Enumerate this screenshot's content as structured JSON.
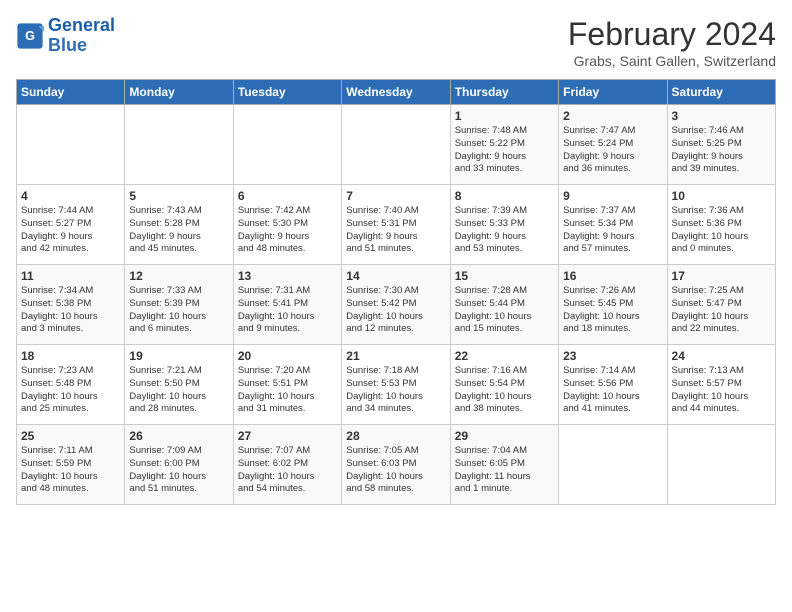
{
  "header": {
    "logo_general": "General",
    "logo_blue": "Blue",
    "month_title": "February 2024",
    "subtitle": "Grabs, Saint Gallen, Switzerland"
  },
  "days_of_week": [
    "Sunday",
    "Monday",
    "Tuesday",
    "Wednesday",
    "Thursday",
    "Friday",
    "Saturday"
  ],
  "weeks": [
    [
      {
        "day": "",
        "info": ""
      },
      {
        "day": "",
        "info": ""
      },
      {
        "day": "",
        "info": ""
      },
      {
        "day": "",
        "info": ""
      },
      {
        "day": "1",
        "info": "Sunrise: 7:48 AM\nSunset: 5:22 PM\nDaylight: 9 hours\nand 33 minutes."
      },
      {
        "day": "2",
        "info": "Sunrise: 7:47 AM\nSunset: 5:24 PM\nDaylight: 9 hours\nand 36 minutes."
      },
      {
        "day": "3",
        "info": "Sunrise: 7:46 AM\nSunset: 5:25 PM\nDaylight: 9 hours\nand 39 minutes."
      }
    ],
    [
      {
        "day": "4",
        "info": "Sunrise: 7:44 AM\nSunset: 5:27 PM\nDaylight: 9 hours\nand 42 minutes."
      },
      {
        "day": "5",
        "info": "Sunrise: 7:43 AM\nSunset: 5:28 PM\nDaylight: 9 hours\nand 45 minutes."
      },
      {
        "day": "6",
        "info": "Sunrise: 7:42 AM\nSunset: 5:30 PM\nDaylight: 9 hours\nand 48 minutes."
      },
      {
        "day": "7",
        "info": "Sunrise: 7:40 AM\nSunset: 5:31 PM\nDaylight: 9 hours\nand 51 minutes."
      },
      {
        "day": "8",
        "info": "Sunrise: 7:39 AM\nSunset: 5:33 PM\nDaylight: 9 hours\nand 53 minutes."
      },
      {
        "day": "9",
        "info": "Sunrise: 7:37 AM\nSunset: 5:34 PM\nDaylight: 9 hours\nand 57 minutes."
      },
      {
        "day": "10",
        "info": "Sunrise: 7:36 AM\nSunset: 5:36 PM\nDaylight: 10 hours\nand 0 minutes."
      }
    ],
    [
      {
        "day": "11",
        "info": "Sunrise: 7:34 AM\nSunset: 5:38 PM\nDaylight: 10 hours\nand 3 minutes."
      },
      {
        "day": "12",
        "info": "Sunrise: 7:33 AM\nSunset: 5:39 PM\nDaylight: 10 hours\nand 6 minutes."
      },
      {
        "day": "13",
        "info": "Sunrise: 7:31 AM\nSunset: 5:41 PM\nDaylight: 10 hours\nand 9 minutes."
      },
      {
        "day": "14",
        "info": "Sunrise: 7:30 AM\nSunset: 5:42 PM\nDaylight: 10 hours\nand 12 minutes."
      },
      {
        "day": "15",
        "info": "Sunrise: 7:28 AM\nSunset: 5:44 PM\nDaylight: 10 hours\nand 15 minutes."
      },
      {
        "day": "16",
        "info": "Sunrise: 7:26 AM\nSunset: 5:45 PM\nDaylight: 10 hours\nand 18 minutes."
      },
      {
        "day": "17",
        "info": "Sunrise: 7:25 AM\nSunset: 5:47 PM\nDaylight: 10 hours\nand 22 minutes."
      }
    ],
    [
      {
        "day": "18",
        "info": "Sunrise: 7:23 AM\nSunset: 5:48 PM\nDaylight: 10 hours\nand 25 minutes."
      },
      {
        "day": "19",
        "info": "Sunrise: 7:21 AM\nSunset: 5:50 PM\nDaylight: 10 hours\nand 28 minutes."
      },
      {
        "day": "20",
        "info": "Sunrise: 7:20 AM\nSunset: 5:51 PM\nDaylight: 10 hours\nand 31 minutes."
      },
      {
        "day": "21",
        "info": "Sunrise: 7:18 AM\nSunset: 5:53 PM\nDaylight: 10 hours\nand 34 minutes."
      },
      {
        "day": "22",
        "info": "Sunrise: 7:16 AM\nSunset: 5:54 PM\nDaylight: 10 hours\nand 38 minutes."
      },
      {
        "day": "23",
        "info": "Sunrise: 7:14 AM\nSunset: 5:56 PM\nDaylight: 10 hours\nand 41 minutes."
      },
      {
        "day": "24",
        "info": "Sunrise: 7:13 AM\nSunset: 5:57 PM\nDaylight: 10 hours\nand 44 minutes."
      }
    ],
    [
      {
        "day": "25",
        "info": "Sunrise: 7:11 AM\nSunset: 5:59 PM\nDaylight: 10 hours\nand 48 minutes."
      },
      {
        "day": "26",
        "info": "Sunrise: 7:09 AM\nSunset: 6:00 PM\nDaylight: 10 hours\nand 51 minutes."
      },
      {
        "day": "27",
        "info": "Sunrise: 7:07 AM\nSunset: 6:02 PM\nDaylight: 10 hours\nand 54 minutes."
      },
      {
        "day": "28",
        "info": "Sunrise: 7:05 AM\nSunset: 6:03 PM\nDaylight: 10 hours\nand 58 minutes."
      },
      {
        "day": "29",
        "info": "Sunrise: 7:04 AM\nSunset: 6:05 PM\nDaylight: 11 hours\nand 1 minute."
      },
      {
        "day": "",
        "info": ""
      },
      {
        "day": "",
        "info": ""
      }
    ]
  ]
}
